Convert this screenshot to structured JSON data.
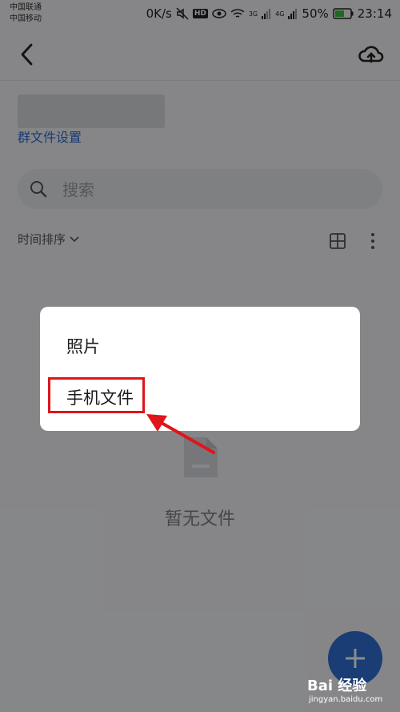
{
  "status_bar": {
    "carrier1": "中国联通",
    "carrier2": "中国移动",
    "speed": "0K/s",
    "hd_label": "HD",
    "network1": "3G",
    "network2": "4G",
    "battery": "50%",
    "time": "23:14"
  },
  "header": {
    "back_icon": "chevron-left-icon",
    "upload_icon": "cloud-upload-icon"
  },
  "group": {
    "settings_link": "群文件设置"
  },
  "search": {
    "placeholder": "搜索"
  },
  "toolbar": {
    "sort_label": "时间排序"
  },
  "empty_state": {
    "text": "暂无文件"
  },
  "dialog": {
    "items": [
      {
        "label": "照片"
      },
      {
        "label": "手机文件"
      }
    ]
  },
  "watermark": {
    "logo": "Bai 经验",
    "url": "jingyan.baidu.com"
  },
  "colors": {
    "accent": "#2f6fd4",
    "link": "#2a6bd1",
    "highlight": "#e0141b"
  }
}
